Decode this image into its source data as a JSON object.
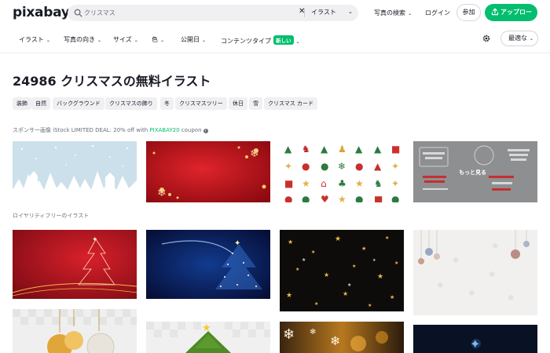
{
  "header": {
    "logo": "pixabay",
    "search_value": "クリスマス",
    "search_type": "イラスト",
    "photo_search": "写真の検索",
    "login": "ログイン",
    "join": "参加",
    "upload": "アップロード",
    "accent": "#02be6e"
  },
  "filters": {
    "items": [
      {
        "label": "イラスト"
      },
      {
        "label": "写真の向き"
      },
      {
        "label": "サイズ"
      },
      {
        "label": "色"
      },
      {
        "label": "公開日"
      },
      {
        "label": "コンテンツタイプ",
        "badge": "新しい"
      }
    ],
    "sort": "最適な"
  },
  "title": "24986 クリスマスの無料イラスト",
  "tags": [
    "装飾",
    "自然",
    "バックグラウンド",
    "クリスマスの飾り",
    "冬",
    "クリスマスツリー",
    "休日",
    "雪",
    "クリスマス カード"
  ],
  "sponsor": {
    "prefix": "スポンサー画像 iStock LIMITED DEAL: 20% off with ",
    "code": "PIXABAY20",
    "suffix": " coupon"
  },
  "sponsored_images": [
    {
      "name": "snowy-village"
    },
    {
      "name": "red-snowflake-background"
    },
    {
      "name": "christmas-icons-grid"
    },
    {
      "name": "holiday-typography",
      "overlay": "もっと見る"
    }
  ],
  "section_label": "ロイヤリティフリーのイラスト",
  "icons": [
    "search-icon",
    "close-icon",
    "chevron-down-icon",
    "upload-icon",
    "gear-icon"
  ]
}
